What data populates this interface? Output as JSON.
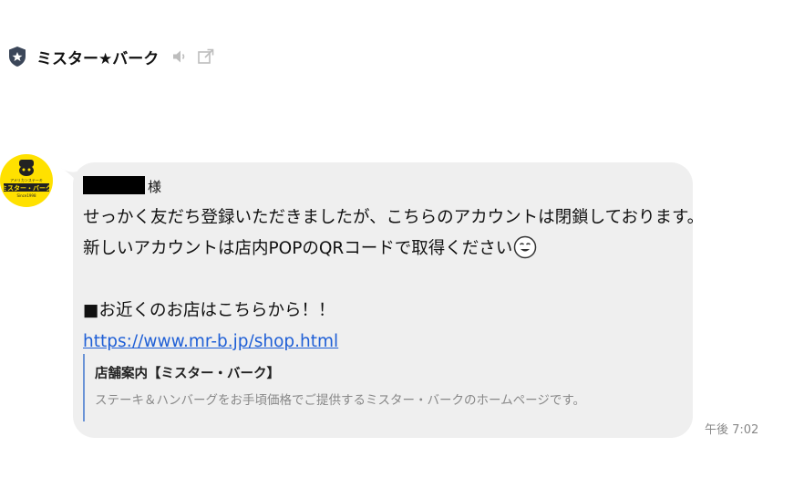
{
  "header": {
    "account_name": "ミスター★バーク",
    "icons": [
      "shield-icon",
      "speaker-mute-icon",
      "external-link-icon"
    ]
  },
  "avatar": {
    "logo_lines": [
      "アメリカンステーキ",
      "ミスター・バーク",
      "Since1998"
    ]
  },
  "message": {
    "recipient_suffix": "様",
    "line1": "せっかく友だち登録いただきましたが、こちらのアカウントは閉鎖しております。",
    "line2": "新しいアカウントは店内POPのQRコードで取得ください",
    "emoji": "smiling-face-emoji",
    "line4": "■お近くのお店はこちらから！！",
    "link": "https://www.mr-b.jp/shop.html"
  },
  "preview": {
    "title": "店舗案内【ミスター・バーク】",
    "description": "ステーキ＆ハンバーグをお手頃価格でご提供するミスター・バークのホームページです。"
  },
  "timestamp": "午後 7:02",
  "colors": {
    "bubble": "#efefef",
    "link": "#1f5fd6",
    "preview_border": "#6a93d6",
    "avatar_bg": "#ffe100"
  }
}
